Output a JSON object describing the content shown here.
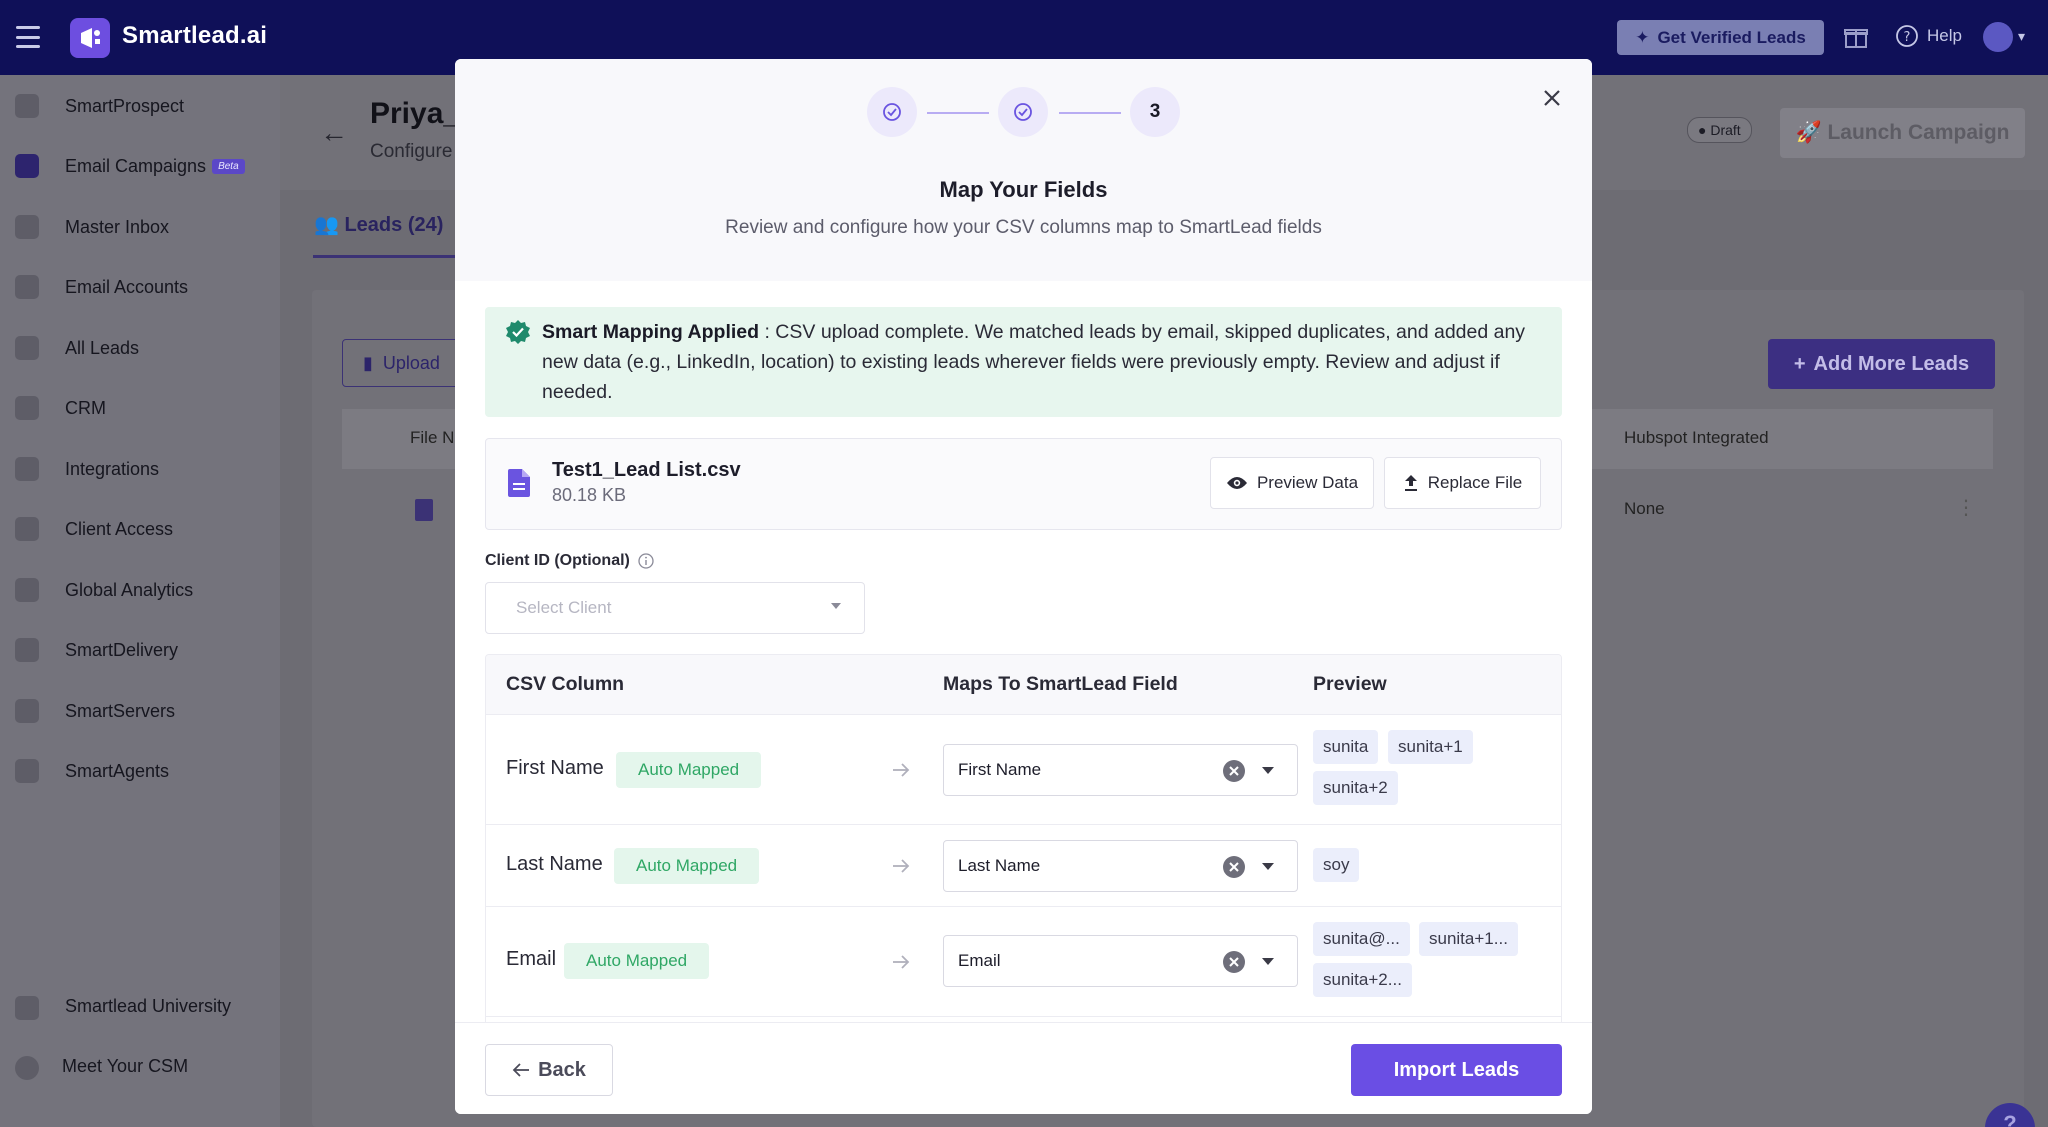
{
  "topbar": {
    "brand": "Smartlead.ai",
    "verified_leads_label": "Get Verified Leads",
    "help_label": "Help"
  },
  "sidebar": {
    "items": [
      {
        "label": "SmartProspect"
      },
      {
        "label": "Email Campaigns",
        "badge": "Beta"
      },
      {
        "label": "Master Inbox"
      },
      {
        "label": "Email Accounts"
      },
      {
        "label": "All Leads"
      },
      {
        "label": "CRM"
      },
      {
        "label": "Integrations"
      },
      {
        "label": "Client Access"
      },
      {
        "label": "Global Analytics"
      },
      {
        "label": "SmartDelivery"
      },
      {
        "label": "SmartServers"
      },
      {
        "label": "SmartAgents"
      }
    ],
    "bottom": [
      {
        "label": "Smartlead University"
      },
      {
        "label": "Meet Your CSM"
      }
    ]
  },
  "background": {
    "title": "Priya_",
    "subtitle": "Configure",
    "draft_label": "Draft",
    "launch_label": "Launch Campaign",
    "tab_label": "Leads (24)",
    "upload_label": "Upload",
    "add_more_label": "Add More Leads",
    "col_file": "File N",
    "col_hubspot": "Hubspot Integrated",
    "row_hubspot": "None"
  },
  "modal": {
    "steps": [
      "",
      "",
      "3"
    ],
    "title": "Map Your Fields",
    "subtitle": "Review and configure how your CSV columns map to SmartLead fields",
    "banner": {
      "strong": "Smart Mapping Applied",
      "text": " : CSV upload complete. We matched leads by email, skipped duplicates, and added any new data (e.g., LinkedIn, location) to existing leads wherever fields were previously empty. Review and adjust if needed."
    },
    "file": {
      "name": "Test1_Lead List.csv",
      "size": "80.18 KB",
      "preview_label": "Preview Data",
      "replace_label": "Replace File"
    },
    "client": {
      "label": "Client ID (Optional)",
      "placeholder": "Select Client"
    },
    "table": {
      "headers": [
        "CSV Column",
        "Maps To SmartLead Field",
        "Preview"
      ],
      "rows": [
        {
          "column": "First Name",
          "status": "Auto Mapped",
          "field": "First Name",
          "preview": [
            "sunita",
            "sunita+1",
            "sunita+2"
          ]
        },
        {
          "column": "Last Name",
          "status": "Auto Mapped",
          "field": "Last Name",
          "preview": [
            "soy"
          ]
        },
        {
          "column": "Email",
          "status": "Auto Mapped",
          "field": "Email",
          "preview": [
            "sunita@...",
            "sunita+1...",
            "sunita+2..."
          ]
        }
      ]
    },
    "footer": {
      "back_label": "Back",
      "import_label": "Import Leads"
    }
  },
  "help_fab": "?"
}
